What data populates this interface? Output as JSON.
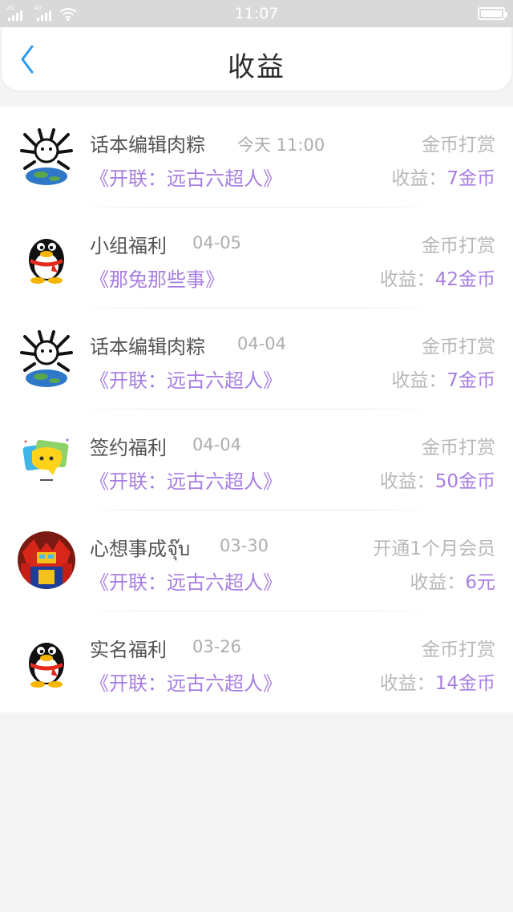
{
  "status_bar": {
    "time": "11:07",
    "network_1": "2G",
    "network_2": "4G",
    "icons": [
      "signal-icon",
      "signal-icon",
      "wifi-icon",
      "battery-icon"
    ]
  },
  "header": {
    "title": "收益",
    "back_icon": "chevron-left-icon"
  },
  "colors": {
    "accent": "#a77ee0",
    "back_icon": "#2b9bf0",
    "muted_text": "#b8b8b8"
  },
  "income_label": "收益：",
  "items": [
    {
      "avatar": "globe-avatar",
      "name": "话本编辑肉粽",
      "date": "今天 11:00",
      "type": "金币打赏",
      "book": "《开联：远古六超人》",
      "amount": "7金币"
    },
    {
      "avatar": "qq-penguin-avatar",
      "name": "小组福利",
      "date": "04-05",
      "type": "金币打赏",
      "book": "《那兔那些事》",
      "amount": "42金币"
    },
    {
      "avatar": "globe-avatar",
      "name": "话本编辑肉粽",
      "date": "04-04",
      "type": "金币打赏",
      "book": "《开联：远古六超人》",
      "amount": "7金币"
    },
    {
      "avatar": "chat-bubble-avatar",
      "name": "签约福利",
      "date": "04-04",
      "type": "金币打赏",
      "book": "《开联：远古六超人》",
      "amount": "50金币"
    },
    {
      "avatar": "robot-avatar",
      "name": "心想事成จุ๊บ",
      "date": "03-30",
      "type": "开通1个月会员",
      "book": "《开联：远古六超人》",
      "amount": "6元"
    },
    {
      "avatar": "qq-penguin-avatar",
      "name": "实名福利",
      "date": "03-26",
      "type": "金币打赏",
      "book": "《开联：远古六超人》",
      "amount": "14金币"
    }
  ]
}
